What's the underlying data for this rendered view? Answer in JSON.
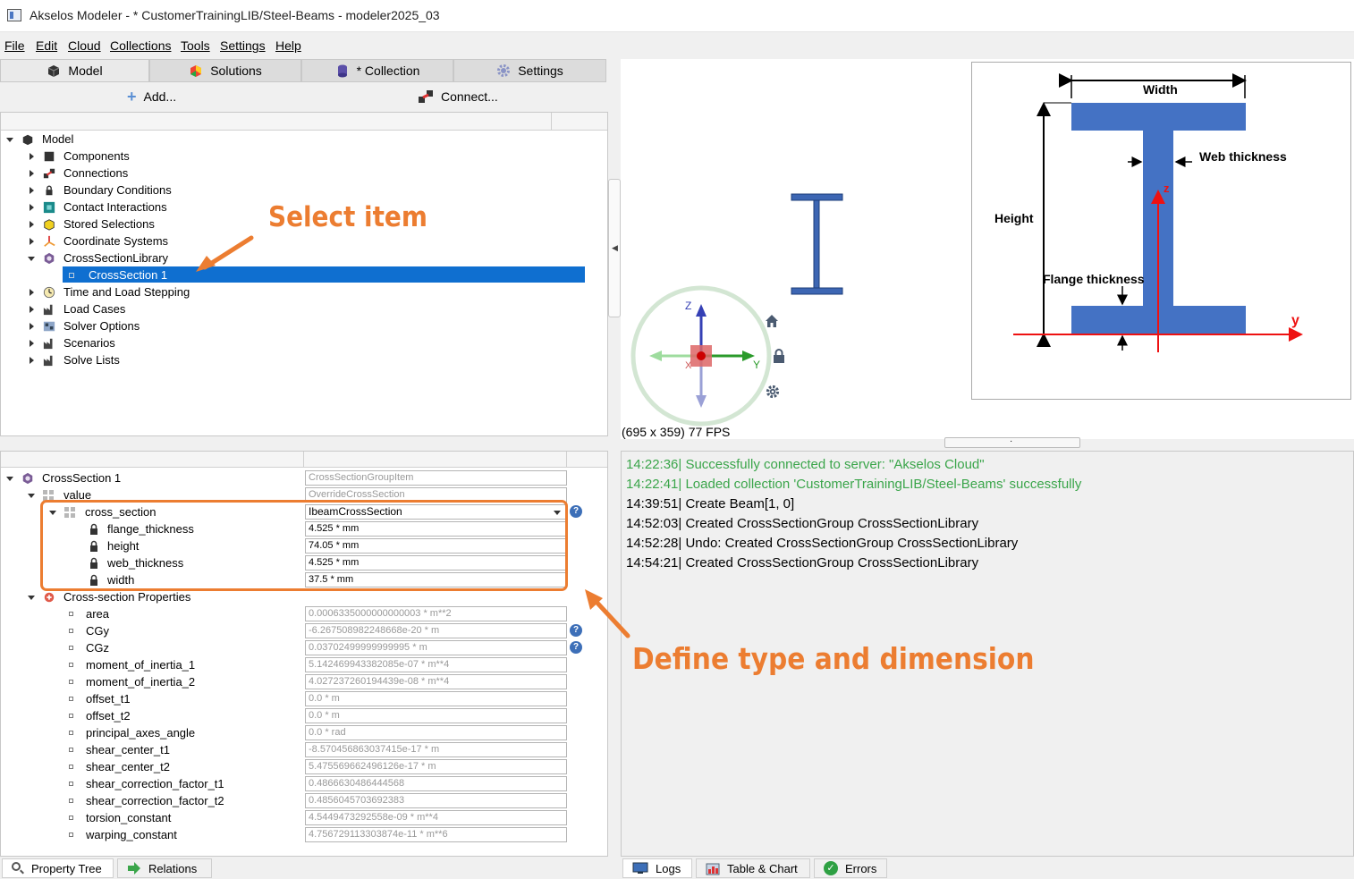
{
  "window": {
    "title": "Akselos Modeler - * CustomerTrainingLIB/Steel-Beams - modeler2025_03"
  },
  "menu": [
    "File",
    "Edit",
    "Cloud",
    "Collections",
    "Tools",
    "Settings",
    "Help"
  ],
  "main_tabs": [
    {
      "label": "Model",
      "icon": "model-icon"
    },
    {
      "label": "Solutions",
      "icon": "solutions-icon"
    },
    {
      "label": "* Collection",
      "icon": "collection-icon"
    },
    {
      "label": "Settings",
      "icon": "settings-gear-icon"
    }
  ],
  "actions": {
    "add": "Add...",
    "connect": "Connect..."
  },
  "tree": {
    "root": "Model",
    "items": [
      "Components",
      "Connections",
      "Boundary Conditions",
      "Contact Interactions",
      "Stored Selections",
      "Coordinate Systems",
      "CrossSectionLibrary",
      "CrossSection 1",
      "Time and Load Stepping",
      "Load Cases",
      "Solver Options",
      "Scenarios",
      "Solve Lists"
    ]
  },
  "viewport": {
    "fps": "(695 x 359) 77 FPS",
    "gizmo_axes": [
      "Z",
      "Y",
      "X"
    ]
  },
  "diagram": {
    "width": "Width",
    "web_thickness": "Web thickness",
    "height": "Height",
    "flange_thickness": "Flange thickness",
    "axis_z": "z",
    "axis_y": "y"
  },
  "properties": {
    "root": "CrossSection 1",
    "root_value": "CrossSectionGroupItem",
    "value_label": "value",
    "value_value": "OverrideCrossSection",
    "cross_section": {
      "label": "cross_section",
      "value": "IbeamCrossSection"
    },
    "dims": [
      {
        "label": "flange_thickness",
        "value": "4.525 * mm"
      },
      {
        "label": "height",
        "value": "74.05 * mm"
      },
      {
        "label": "web_thickness",
        "value": "4.525 * mm"
      },
      {
        "label": "width",
        "value": "37.5 * mm"
      }
    ],
    "cs_props_label": "Cross-section Properties",
    "cs_props": [
      {
        "label": "area",
        "value": "0.0006335000000000003 * m**2"
      },
      {
        "label": "CGy",
        "value": "-6.267508982248668e-20 * m"
      },
      {
        "label": "CGz",
        "value": "0.03702499999999995 * m"
      },
      {
        "label": "moment_of_inertia_1",
        "value": "5.142469943382085e-07 * m**4"
      },
      {
        "label": "moment_of_inertia_2",
        "value": "4.027237260194439e-08 * m**4"
      },
      {
        "label": "offset_t1",
        "value": "0.0 * m"
      },
      {
        "label": "offset_t2",
        "value": "0.0 * m"
      },
      {
        "label": "principal_axes_angle",
        "value": "0.0 * rad"
      },
      {
        "label": "shear_center_t1",
        "value": "-8.570456863037415e-17 * m"
      },
      {
        "label": "shear_center_t2",
        "value": "5.475569662496126e-17 * m"
      },
      {
        "label": "shear_correction_factor_t1",
        "value": "0.4866630486444568"
      },
      {
        "label": "shear_correction_factor_t2",
        "value": "0.4856045703692383"
      },
      {
        "label": "torsion_constant",
        "value": "4.5449473292558e-09 * m**4"
      },
      {
        "label": "warping_constant",
        "value": "4.756729113303874e-11 * m**6"
      }
    ]
  },
  "logs": [
    {
      "text": "14:22:36| Successfully connected to server: \"Akselos Cloud\"",
      "status": "success"
    },
    {
      "text": "14:22:41| Loaded collection 'CustomerTrainingLIB/Steel-Beams' successfully",
      "status": "success"
    },
    {
      "text": "14:39:51| Create Beam[1, 0]",
      "status": "info"
    },
    {
      "text": "14:52:03| Created CrossSectionGroup CrossSectionLibrary",
      "status": "info"
    },
    {
      "text": "14:52:28| Undo: Created CrossSectionGroup CrossSectionLibrary",
      "status": "info"
    },
    {
      "text": "14:54:21| Created CrossSectionGroup CrossSectionLibrary",
      "status": "info"
    }
  ],
  "bottom_tabs_left": [
    "Property Tree",
    "Relations"
  ],
  "bottom_tabs_right": [
    "Logs",
    "Table & Chart",
    "Errors"
  ],
  "annotations": {
    "select_item": "Select item",
    "define": "Define type and dimension"
  },
  "colors": {
    "accent": "#ec7d31",
    "selection": "#0f6fd0",
    "beam": "#4472c4",
    "success": "#3aa54a"
  }
}
